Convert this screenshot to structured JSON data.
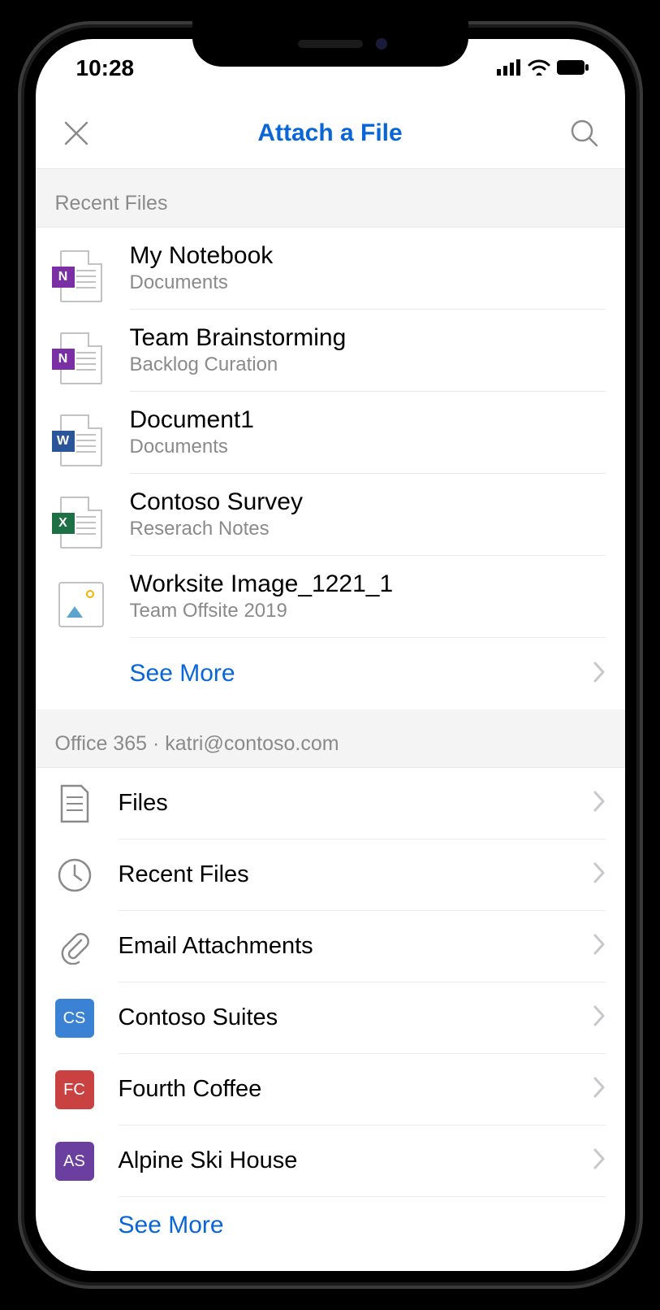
{
  "status": {
    "time": "10:28"
  },
  "nav": {
    "title": "Attach a File"
  },
  "sections": {
    "recent": {
      "header": "Recent Files",
      "see_more": "See More",
      "items": [
        {
          "title": "My Notebook",
          "sub": "Documents",
          "type": "onenote"
        },
        {
          "title": "Team Brainstorming",
          "sub": "Backlog Curation",
          "type": "onenote"
        },
        {
          "title": "Document1",
          "sub": "Documents",
          "type": "word"
        },
        {
          "title": "Contoso Survey",
          "sub": "Reserach Notes",
          "type": "excel"
        },
        {
          "title": "Worksite Image_1221_1",
          "sub": "Team Offsite 2019",
          "type": "image"
        }
      ]
    },
    "account": {
      "header": "Office 365 · katri@contoso.com",
      "see_more": "See More",
      "items": [
        {
          "label": "Files",
          "icon": "files"
        },
        {
          "label": "Recent Files",
          "icon": "clock"
        },
        {
          "label": "Email Attachments",
          "icon": "clip"
        },
        {
          "label": "Contoso Suites",
          "icon": "badge",
          "initials": "CS",
          "color": "#3b82d4"
        },
        {
          "label": "Fourth Coffee",
          "icon": "badge",
          "initials": "FC",
          "color": "#c94141"
        },
        {
          "label": "Alpine Ski House",
          "icon": "badge",
          "initials": "AS",
          "color": "#6b3fa0"
        }
      ]
    }
  }
}
